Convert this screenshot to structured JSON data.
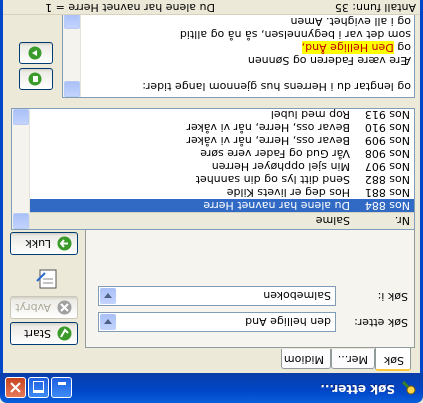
{
  "window": {
    "title": "Søk etter..."
  },
  "tabs": [
    {
      "label": "Søk"
    },
    {
      "label": "Mer..."
    },
    {
      "label": "Midiom"
    }
  ],
  "search_panel": {
    "scope_label": "Søk i:",
    "scope_value": "Salmeboken",
    "query_label": "Søk etter:",
    "query_value": "den hellige And"
  },
  "buttons": {
    "start": "Start",
    "abort": "Avbryt",
    "close": "Lukk"
  },
  "results": {
    "columns": {
      "nr": "Nr.",
      "title": "Salme"
    },
    "rows": [
      {
        "nr": "Nos 884",
        "title": "Du alene har navnet Herre",
        "selected": true
      },
      {
        "nr": "Nos 881",
        "title": "Hos deg er livets Kilde"
      },
      {
        "nr": "Nos 882",
        "title": "Send ditt lys og din sannhet"
      },
      {
        "nr": "Nos 907",
        "title": "Min sjel opphøyer Herren"
      },
      {
        "nr": "Nos 908",
        "title": "Vår Gud og Fader vere søre"
      },
      {
        "nr": "Nos 909",
        "title": "Bevar oss, Herre, når vi våker"
      },
      {
        "nr": "Nos 910",
        "title": "Bevar oss, Herre, når vi våker"
      },
      {
        "nr": "Nos 913",
        "title": "Rop med lubel"
      }
    ]
  },
  "text_view": {
    "lines": [
      {
        "before": "og lengtar du i Herrens hus gjennom lange tider:",
        "hl": "",
        "after": ""
      },
      {
        "before": "",
        "hl": "",
        "after": ""
      },
      {
        "before": "Ære være Faderen og Sønnen",
        "hl": "",
        "after": ""
      },
      {
        "before": "og ",
        "hl": "Den Hellige Ånd,",
        "after": ""
      },
      {
        "before": "som det var i begynnelsen, så nå og alltid",
        "hl": "",
        "after": ""
      },
      {
        "before": "og i all evighet. Amen",
        "hl": "",
        "after": ""
      }
    ]
  },
  "status": {
    "count_label": "Antall funn: 35",
    "match_text": "Du alene har navnet Herre = 1"
  },
  "colors": {
    "titlebar": "#0046c8",
    "selection": "#316ac5",
    "highlight_bg": "#ffff00",
    "highlight_fg": "#c00000"
  },
  "icons": [
    "app-search-icon",
    "minimize-icon",
    "maximize-icon",
    "close-icon",
    "start-icon",
    "abort-icon",
    "book-icon",
    "close-lukk-icon",
    "next-icon",
    "copy-icon"
  ]
}
